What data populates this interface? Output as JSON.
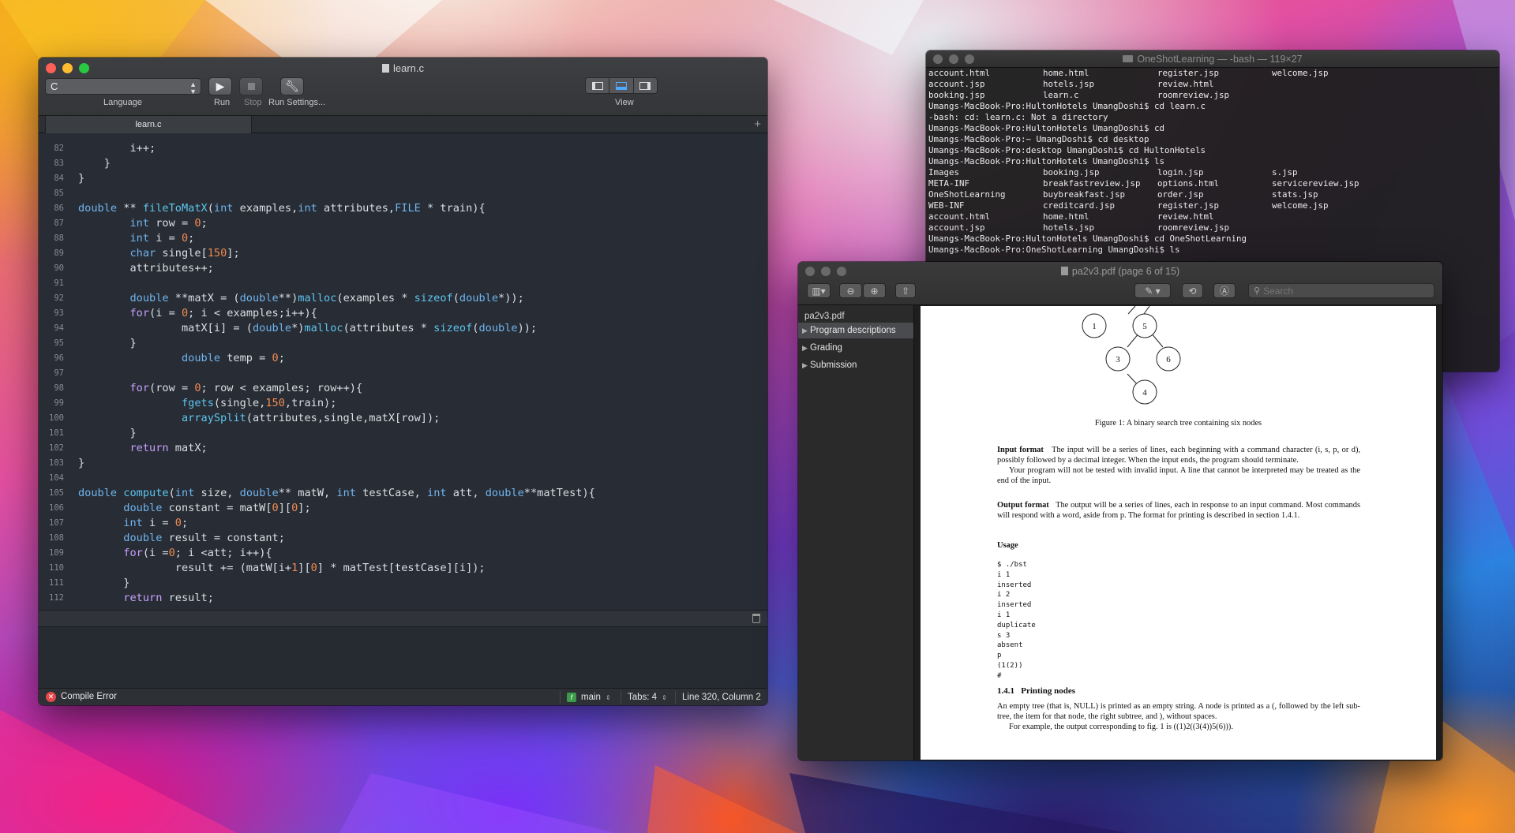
{
  "editor": {
    "title": "learn.c",
    "language_value": "C",
    "language_label": "Language",
    "run_label": "Run",
    "stop_label": "Stop",
    "run_settings_label": "Run Settings...",
    "view_label": "View",
    "tab": "learn.c",
    "add_tab": "+",
    "code": [
      {
        "n": "82",
        "t": "        i++;"
      },
      {
        "n": "83",
        "t": "    }"
      },
      {
        "n": "84",
        "t": "}"
      },
      {
        "n": "85",
        "t": ""
      },
      {
        "n": "86",
        "t": "double ** fileToMatX(int examples,int attributes,FILE * train){"
      },
      {
        "n": "87",
        "t": "        int row = 0;"
      },
      {
        "n": "88",
        "t": "        int i = 0;"
      },
      {
        "n": "89",
        "t": "        char single[150];"
      },
      {
        "n": "90",
        "t": "        attributes++;"
      },
      {
        "n": "91",
        "t": ""
      },
      {
        "n": "92",
        "t": "        double **matX = (double**)malloc(examples * sizeof(double*));"
      },
      {
        "n": "93",
        "t": "        for(i = 0; i < examples;i++){"
      },
      {
        "n": "94",
        "t": "                matX[i] = (double*)malloc(attributes * sizeof(double));"
      },
      {
        "n": "95",
        "t": "        }"
      },
      {
        "n": "96",
        "t": "                double temp = 0;"
      },
      {
        "n": "97",
        "t": ""
      },
      {
        "n": "98",
        "t": "        for(row = 0; row < examples; row++){"
      },
      {
        "n": "99",
        "t": "                fgets(single,150,train);"
      },
      {
        "n": "100",
        "t": "                arraySplit(attributes,single,matX[row]);"
      },
      {
        "n": "101",
        "t": "        }"
      },
      {
        "n": "102",
        "t": "        return matX;"
      },
      {
        "n": "103",
        "t": "}"
      },
      {
        "n": "104",
        "t": ""
      },
      {
        "n": "105",
        "t": "double compute(int size, double** matW, int testCase, int att, double**matTest){"
      },
      {
        "n": "106",
        "t": "       double constant = matW[0][0];"
      },
      {
        "n": "107",
        "t": "       int i = 0;"
      },
      {
        "n": "108",
        "t": "       double result = constant;"
      },
      {
        "n": "109",
        "t": "       for(i =0; i <att; i++){"
      },
      {
        "n": "110",
        "t": "               result += (matW[i+1][0] * matTest[testCase][i]);"
      },
      {
        "n": "111",
        "t": "       }"
      },
      {
        "n": "112",
        "t": "       return result;"
      }
    ],
    "status": {
      "compile": "Compile Error",
      "scheme": "main",
      "tabs": "Tabs: 4",
      "position": "Line 320, Column 2"
    }
  },
  "terminal": {
    "title": "OneShotLearning — -bash — 119×27",
    "lines": [
      [
        "account.html",
        "home.html",
        "register.jsp",
        "welcome.jsp"
      ],
      [
        "account.jsp",
        "hotels.jsp",
        "review.html"
      ],
      [
        "booking.jsp",
        "learn.c",
        "roomreview.jsp"
      ],
      [
        "Umangs-MacBook-Pro:HultonHotels UmangDoshi$ cd learn.c"
      ],
      [
        "-bash: cd: learn.c: Not a directory"
      ],
      [
        "Umangs-MacBook-Pro:HultonHotels UmangDoshi$ cd"
      ],
      [
        "Umangs-MacBook-Pro:~ UmangDoshi$ cd desktop"
      ],
      [
        "Umangs-MacBook-Pro:desktop UmangDoshi$ cd HultonHotels"
      ],
      [
        "Umangs-MacBook-Pro:HultonHotels UmangDoshi$ ls"
      ],
      [
        "Images",
        "booking.jsp",
        "login.jsp",
        "s.jsp"
      ],
      [
        "META-INF",
        "breakfastreview.jsp",
        "options.html",
        "servicereview.jsp"
      ],
      [
        "OneShotLearning",
        "buybreakfast.jsp",
        "order.jsp",
        "stats.jsp"
      ],
      [
        "WEB-INF",
        "creditcard.jsp",
        "register.jsp",
        "welcome.jsp"
      ],
      [
        "account.html",
        "home.html",
        "review.html"
      ],
      [
        "account.jsp",
        "hotels.jsp",
        "roomreview.jsp"
      ],
      [
        "Umangs-MacBook-Pro:HultonHotels UmangDoshi$ cd OneShotLearning"
      ],
      [
        "Umangs-MacBook-Pro:OneShotLearning UmangDoshi$ ls"
      ]
    ]
  },
  "preview": {
    "title": "pa2v3.pdf (page 6 of 15)",
    "search_placeholder": "Search",
    "filename": "pa2v3.pdf",
    "sidebar": [
      "Program descriptions",
      "Grading",
      "Submission"
    ],
    "tree_nodes": [
      "1",
      "5",
      "3",
      "6",
      "4"
    ],
    "caption": "Figure 1: A binary search tree containing six nodes",
    "input_heading": "Input format",
    "input_text": "The input will be a series of lines, each beginning with a command character (i, s, p, or d), possibly followed by a decimal integer. When the input ends, the program should terminate.",
    "input_text2": "Your program will not be tested with invalid input. A line that cannot be interpreted may be treated as the end of the input.",
    "output_heading": "Output format",
    "output_text": "The output will be a series of lines, each in response to an input command. Most commands will respond with a word, aside from p. The format for printing is described in section 1.4.1.",
    "usage_heading": "Usage",
    "usage_lines": [
      "$ ./bst",
      "i 1",
      "inserted",
      "i 2",
      "inserted",
      "i 1",
      "duplicate",
      "s 3",
      "absent",
      "p",
      "(1(2))",
      "#"
    ],
    "section_heading": "1.4.1   Printing nodes",
    "printing_text": "An empty tree (that is, NULL) is printed as an empty string. A node is printed as a (, followed by the left sub-tree, the item for that node, the right subtree, and ), without spaces.",
    "example_text": "For example, the output corresponding to fig. 1 is ((1)2((3(4))5(6)))."
  }
}
